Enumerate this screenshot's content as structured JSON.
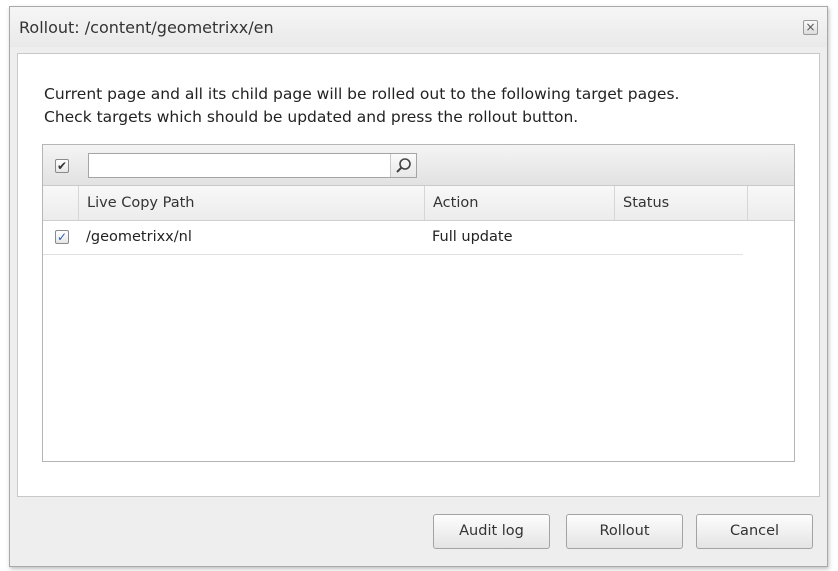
{
  "window": {
    "title": "Rollout: /content/geometrixx/en",
    "close_glyph": "×"
  },
  "message": {
    "line1": "Current page and all its child page will be rolled out to the following target pages.",
    "line2": "Check targets which should be updated and press the rollout button."
  },
  "grid": {
    "select_all_checked": true,
    "search": {
      "value": "",
      "placeholder": ""
    },
    "columns": [
      "Live Copy Path",
      "Action",
      "Status"
    ],
    "rows": [
      {
        "checked": true,
        "path": "/geometrixx/nl",
        "action": "Full update",
        "status": ""
      }
    ]
  },
  "buttons": {
    "audit_log": "Audit log",
    "rollout": "Rollout",
    "cancel": "Cancel"
  },
  "icons": {
    "check": "✔",
    "check_small": "✓",
    "search": "search-icon",
    "close": "close-icon"
  },
  "colors": {
    "dialog_bg": "#eeeeee",
    "panel_bg": "#ffffff",
    "check_blue": "#2a5db0"
  }
}
